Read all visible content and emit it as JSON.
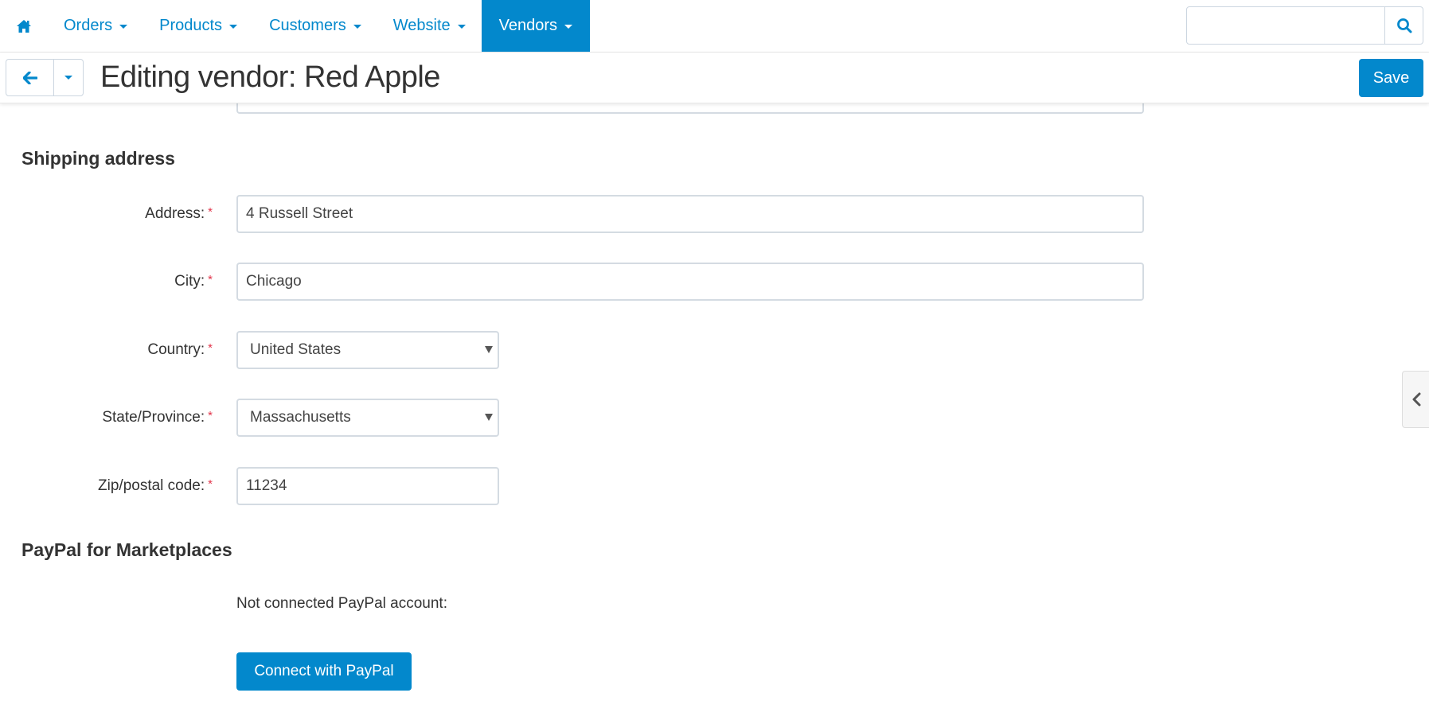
{
  "topnav": {
    "home_icon": "home-icon",
    "items": [
      {
        "label": "Orders",
        "active": false
      },
      {
        "label": "Products",
        "active": false
      },
      {
        "label": "Customers",
        "active": false
      },
      {
        "label": "Website",
        "active": false
      },
      {
        "label": "Vendors",
        "active": true
      }
    ],
    "search": {
      "placeholder": "",
      "value": "",
      "icon": "search-icon"
    }
  },
  "header": {
    "back_icon": "arrow-left-icon",
    "title": "Editing vendor: Red Apple",
    "save_label": "Save"
  },
  "shipping": {
    "title": "Shipping address",
    "fields": {
      "address": {
        "label": "Address:",
        "value": "4 Russell Street",
        "required": true
      },
      "city": {
        "label": "City:",
        "value": "Chicago",
        "required": true
      },
      "country": {
        "label": "Country:",
        "value": "United States",
        "required": true
      },
      "state": {
        "label": "State/Province:",
        "value": "Massachusetts",
        "required": true
      },
      "zip": {
        "label": "Zip/postal code:",
        "value": "11234",
        "required": true
      }
    },
    "required_mark": "*"
  },
  "paypal": {
    "title": "PayPal for Marketplaces",
    "account_label": "PayPal account:",
    "account_value": "Not connected",
    "connect_label": "Connect with PayPal"
  },
  "colors": {
    "accent": "#0388cc",
    "required": "#e2354b",
    "text": "#333333"
  }
}
